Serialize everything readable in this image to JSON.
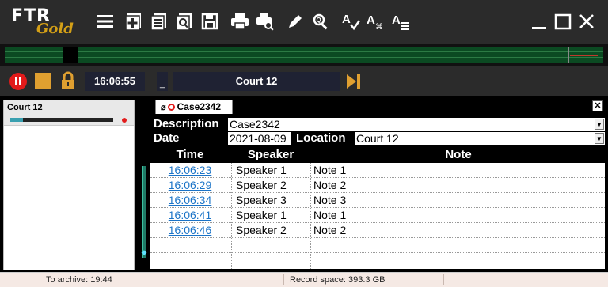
{
  "app": {
    "logo_text": "FTR",
    "logo_sub": "Gold"
  },
  "toolbar": {
    "icons": [
      "menu-icon",
      "new-note-icon",
      "notes-list-icon",
      "search-notes-icon",
      "save-icon",
      "print-icon",
      "print-preview-icon",
      "edit-pen-icon",
      "zoom-icon",
      "spellcheck-icon",
      "autocorrect-icon",
      "text-format-icon"
    ]
  },
  "window_controls": [
    "minimize-icon",
    "maximize-icon",
    "close-icon"
  ],
  "transport": {
    "time": "16:06:55",
    "small_box": "_",
    "channel": "Court 12",
    "colors": {
      "record": "#e21b1b",
      "stop": "#e0a030",
      "skip": "#e0a030"
    }
  },
  "rooms": [
    {
      "name": "Court 12",
      "level": 0.12
    }
  ],
  "tabs": [
    {
      "label": "Case2342"
    }
  ],
  "meta": {
    "description_label": "Description",
    "description_value": "Case2342",
    "date_label": "Date",
    "date_value": "2021-08-09",
    "location_label": "Location",
    "location_value": "Court 12"
  },
  "table": {
    "headers": [
      "Time",
      "Speaker",
      "Note"
    ],
    "rows": [
      {
        "time": "16:06:23",
        "speaker": "Speaker 1",
        "note": "Note 1"
      },
      {
        "time": "16:06:29",
        "speaker": "Speaker 2",
        "note": "Note 2"
      },
      {
        "time": "16:06:34",
        "speaker": "Speaker 3",
        "note": "Note 3"
      },
      {
        "time": "16:06:41",
        "speaker": "Speaker 1",
        "note": "Note 1"
      },
      {
        "time": "16:06:46",
        "speaker": "Speaker 2",
        "note": "Note 2"
      }
    ]
  },
  "status": {
    "archive": "To archive: 19:44",
    "space": "Record space: 393.3 GB"
  }
}
